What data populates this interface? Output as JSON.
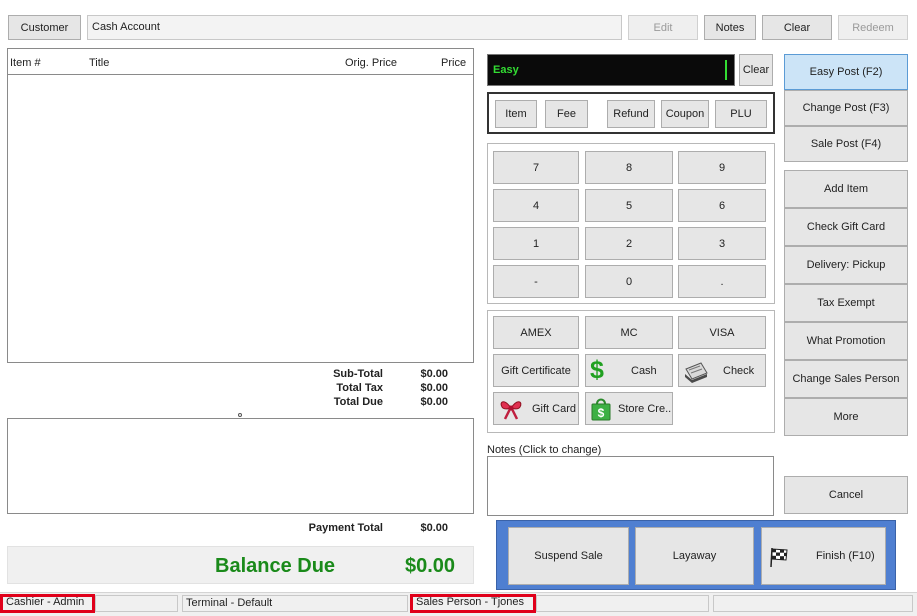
{
  "top": {
    "customer_button": "Customer",
    "customer_value": "Cash Account",
    "edit": "Edit",
    "notes": "Notes",
    "clear": "Clear",
    "redeem": "Redeem"
  },
  "items_table": {
    "headers": {
      "item": "Item #",
      "title": "Title",
      "orig_price": "Orig. Price",
      "price": "Price"
    }
  },
  "totals": {
    "subtotal_label": "Sub-Total",
    "subtotal": "$0.00",
    "tax_label": "Total Tax",
    "tax": "$0.00",
    "due_label": "Total Due",
    "due": "$0.00",
    "payment_total_label": "Payment Total",
    "payment_total": "$0.00",
    "balance_label": "Balance Due",
    "balance": "$0.00"
  },
  "entry": {
    "mode": "Easy",
    "clear": "Clear"
  },
  "entry_types": [
    "Item",
    "Fee",
    "Refund",
    "Coupon",
    "PLU"
  ],
  "keypad": [
    "7",
    "8",
    "9",
    "4",
    "5",
    "6",
    "1",
    "2",
    "3",
    "-",
    "0",
    "."
  ],
  "tenders": {
    "amex": "AMEX",
    "mc": "MC",
    "visa": "VISA",
    "gift_certificate": "Gift Certificate",
    "cash": "Cash",
    "check": "Check",
    "gift_card": "Gift Card",
    "store_credit": "Store Cre..."
  },
  "notes_label": "Notes (Click to change)",
  "right_actions": {
    "easy_post": "Easy Post (F2)",
    "change_post": "Change Post (F3)",
    "sale_post": "Sale Post (F4)",
    "add_item": "Add Item",
    "check_gift_card": "Check Gift Card",
    "delivery": "Delivery: Pickup",
    "tax_exempt": "Tax Exempt",
    "what_promotion": "What Promotion",
    "change_sales_person": "Change Sales Person",
    "more": "More",
    "cancel": "Cancel"
  },
  "bottom_actions": {
    "suspend": "Suspend Sale",
    "layaway": "Layaway",
    "finish": "Finish (F10)"
  },
  "status": {
    "cashier": "Cashier - Admin",
    "terminal": "Terminal - Default",
    "sales_person": "Sales Person - Tjones"
  },
  "colors": {
    "balance_green": "#1a8a1a",
    "entry_green": "#33dd33",
    "focus_blue": "#cce4f7",
    "finish_panel_blue": "#4f7fd1",
    "highlight_red": "#e0001a"
  }
}
